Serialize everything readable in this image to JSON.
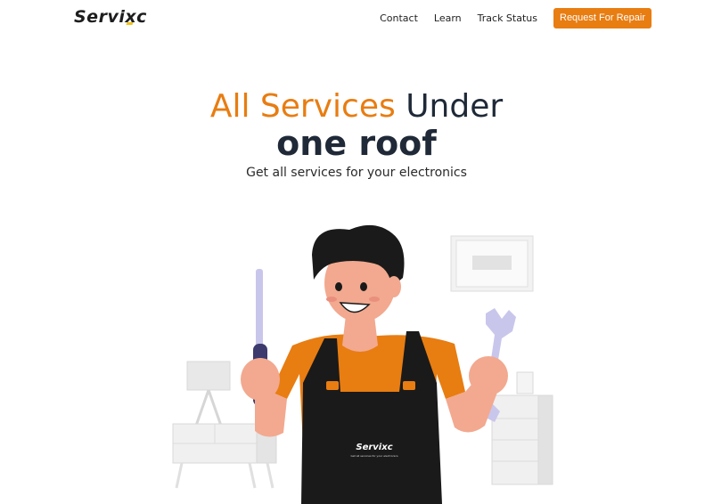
{
  "brand": {
    "name_prefix": "Servi",
    "name_x": "x",
    "name_suffix": "c"
  },
  "nav": {
    "links": [
      "Contact",
      "Learn",
      "Track Status"
    ],
    "cta_label": "Request For Repair"
  },
  "hero": {
    "title_accent": "All Services",
    "title_rest": "Under",
    "title_line2": "one roof",
    "subtitle": "Get all services for your electronics"
  },
  "apron": {
    "logo_text": "Servixc",
    "tagline": "Get all services for your electronics"
  },
  "colors": {
    "accent": "#e87d12",
    "dark": "#1f2937"
  }
}
